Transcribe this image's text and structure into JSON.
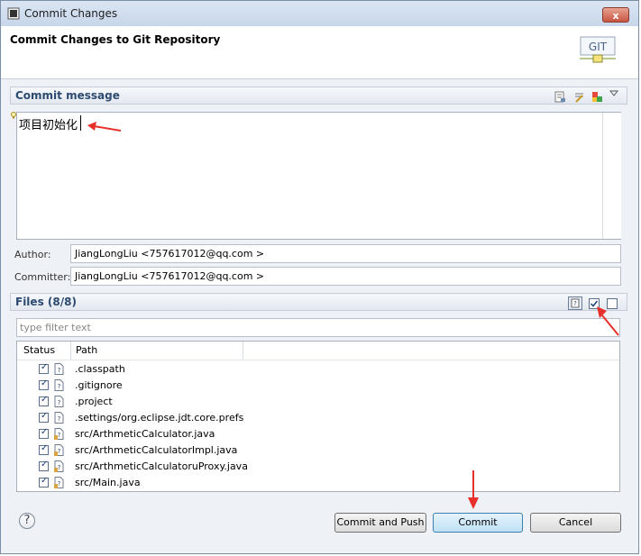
{
  "window": {
    "title": "Commit Changes",
    "close_label": "x"
  },
  "header": {
    "title": "Commit Changes to Git Repository",
    "logo_text": "GIT"
  },
  "commit_message": {
    "section_title": "Commit message",
    "text": "项目初始化"
  },
  "author": {
    "label": "Author:",
    "value": "JiangLongLiu <757617012@qq.com      >"
  },
  "committer": {
    "label": "Committer:",
    "value": "JiangLongLiu <757617012@qq.com      >"
  },
  "files": {
    "section_title": "Files (8/8)",
    "filter_placeholder": "type filter text",
    "columns": [
      "Status",
      "Path"
    ],
    "items": [
      {
        "path": ".classpath",
        "icon": "untracked-file-icon"
      },
      {
        "path": ".gitignore",
        "icon": "untracked-file-icon"
      },
      {
        "path": ".project",
        "icon": "untracked-file-icon"
      },
      {
        "path": ".settings/org.eclipse.jdt.core.prefs",
        "icon": "untracked-file-icon"
      },
      {
        "path": "src/ArthmeticCalculator.java",
        "icon": "java-file-icon"
      },
      {
        "path": "src/ArthmeticCalculatorImpl.java",
        "icon": "java-file-icon"
      },
      {
        "path": "src/ArthmeticCalculatoruProxy.java",
        "icon": "java-file-icon"
      },
      {
        "path": "src/Main.java",
        "icon": "java-file-icon"
      }
    ]
  },
  "buttons": {
    "help": "?",
    "commit_and_push": "Commit and Push",
    "commit": "Commit",
    "cancel": "Cancel"
  },
  "colors": {
    "accent": "#2c4a70",
    "annotation": "#e8302a"
  }
}
